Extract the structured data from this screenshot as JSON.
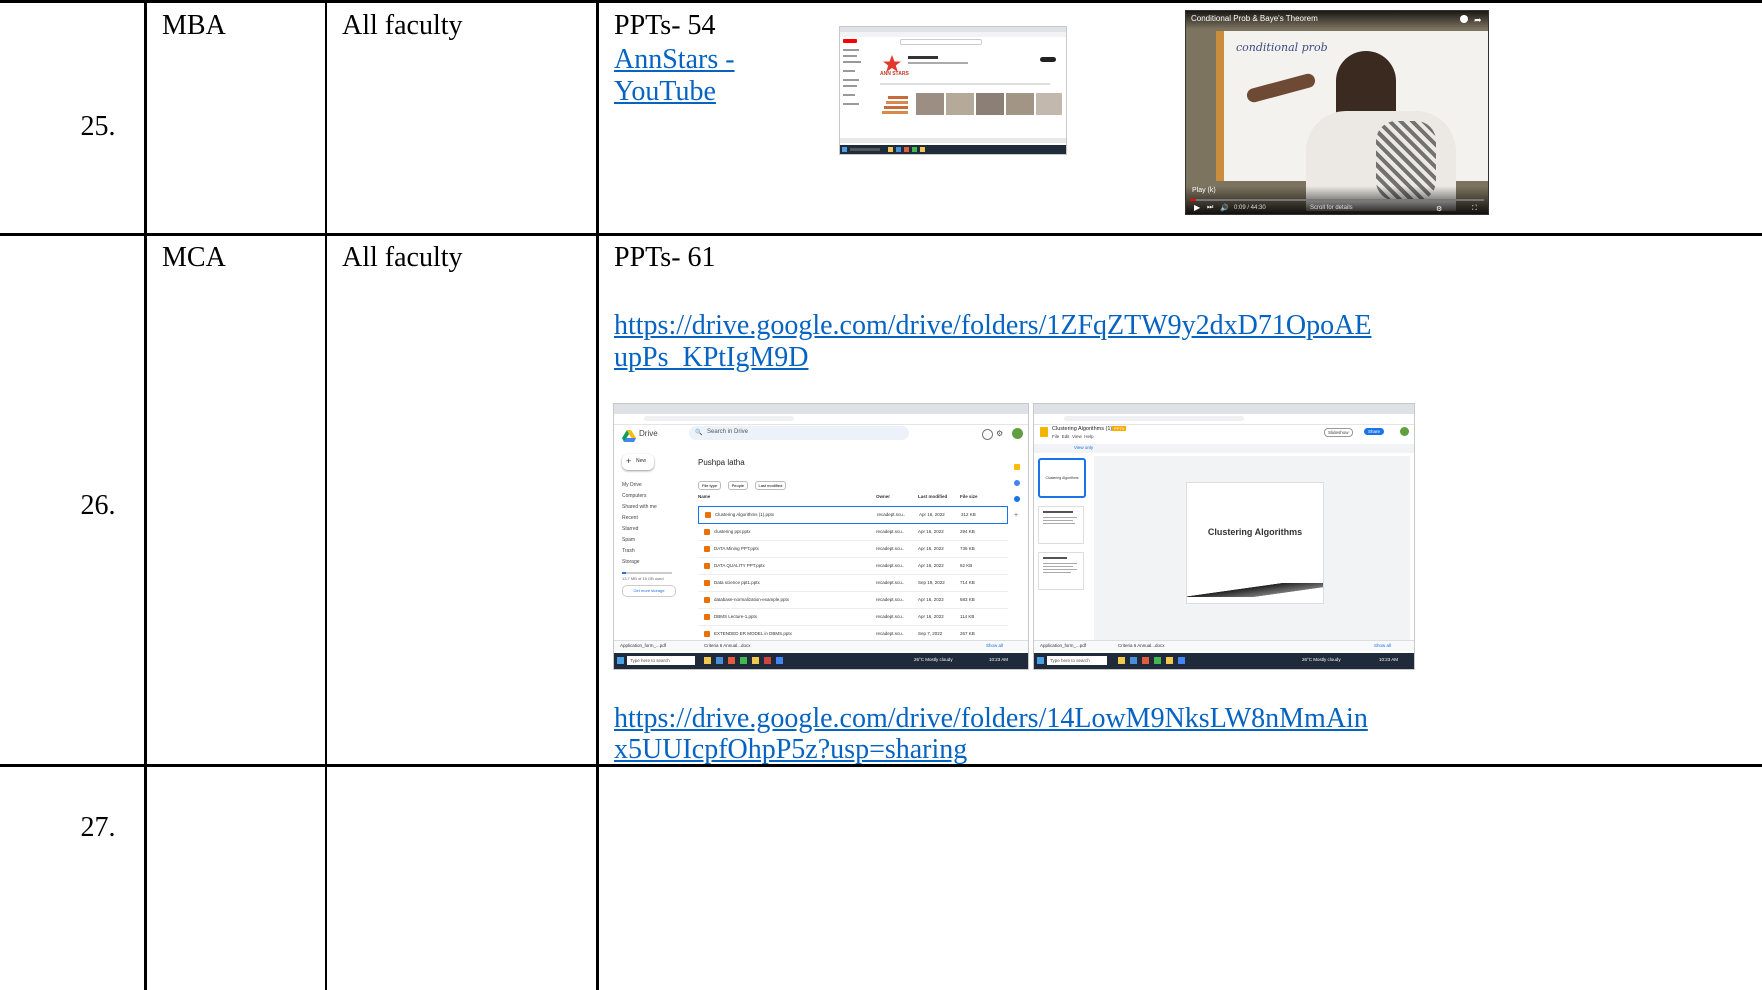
{
  "rows": [
    {
      "number": "25.",
      "program": "MBA",
      "faculty": "All faculty",
      "ppt_label": "PPTs- 54",
      "link_line1": "AnnStars -",
      "link_line2": "YouTube",
      "thumb_yt_channel": "ANN STARS",
      "thumb_video_title": "Conditional Prob & Baye's Theorem",
      "thumb_video_handwriting": "conditional prob",
      "thumb_video_play": "Play (k)",
      "thumb_video_time": "0:09 / 44:30",
      "thumb_video_scroll": "Scroll for details"
    },
    {
      "number": "26.",
      "program": "MCA",
      "faculty": "All faculty",
      "ppt_label": "PPTs- 61",
      "link1_line1": "https://drive.google.com/drive/folders/1ZFqZTW9y2dxD71OpoAE",
      "link1_line2": "upPs_KPtIgM9D",
      "link2_line1": "https://drive.google.com/drive/folders/14LowM9NksLW8nMmAin",
      "link2_line2": "x5UUIcpfOhpP5z?usp=sharing",
      "drive": {
        "app": "Drive",
        "search_placeholder": "Search in Drive",
        "new_label": "New",
        "folder": "Pushpa latha",
        "sidebar": [
          "My Drive",
          "Computers",
          "Shared with me",
          "Recent",
          "Starred",
          "Spam",
          "Trash",
          "Storage"
        ],
        "storage_text": "13.7 MB of 15 GB used",
        "get_storage": "Get more storage",
        "filters": [
          "File type",
          "People",
          "Last modified"
        ],
        "columns": [
          "Name",
          "Owner",
          "Last modified",
          "File size"
        ],
        "files": [
          {
            "name": "Clustering Algorithms (1).pptx",
            "owner": "recadept.scu..",
            "modified": "Apr 16, 2022",
            "size": "312 KB"
          },
          {
            "name": "clustering ppt.pptx",
            "owner": "recadept.scu..",
            "modified": "Apr 16, 2022",
            "size": "294 KB"
          },
          {
            "name": "DATA Mining PPT.pptx",
            "owner": "recadept.scu..",
            "modified": "Apr 16, 2022",
            "size": "736 KB"
          },
          {
            "name": "DATA QUALITY PPT.pptx",
            "owner": "recadept.scu..",
            "modified": "Apr 16, 2022",
            "size": "62 KB"
          },
          {
            "name": "Data science ppt1.pptx",
            "owner": "recadept.scu..",
            "modified": "Sep 19, 2022",
            "size": "714 KB"
          },
          {
            "name": "database-normalization-example.pptx",
            "owner": "recadept.scu..",
            "modified": "Apr 16, 2022",
            "size": "683 KB"
          },
          {
            "name": "DBMS Lecture-1.pptx",
            "owner": "recadept.scu..",
            "modified": "Apr 16, 2022",
            "size": "114 KB"
          },
          {
            "name": "EXTENDED ER MODEL in DBMS.pptx",
            "owner": "recadept.scu..",
            "modified": "Sep 7, 2022",
            "size": "267 KB"
          }
        ],
        "taskbar_search": "Type here to search",
        "weather": "26°C Mostly cloudy",
        "time": "10:23 AM",
        "downloads": [
          "Application_form_...pdf",
          "Criteria 6 Annual...docx"
        ],
        "show_all": "Show all"
      },
      "slides": {
        "title": "Clustering Algorithms (1)",
        "badge": "PPTX",
        "menu": [
          "File",
          "Edit",
          "View",
          "Help"
        ],
        "view_only": "View only",
        "slideshow": "Slideshow",
        "share": "Share",
        "main_slide_title": "Clustering Algorithms",
        "thumb1": "Clustering Algorithms"
      }
    },
    {
      "number": "27.",
      "program": "",
      "faculty": "",
      "ppt_label": ""
    }
  ]
}
